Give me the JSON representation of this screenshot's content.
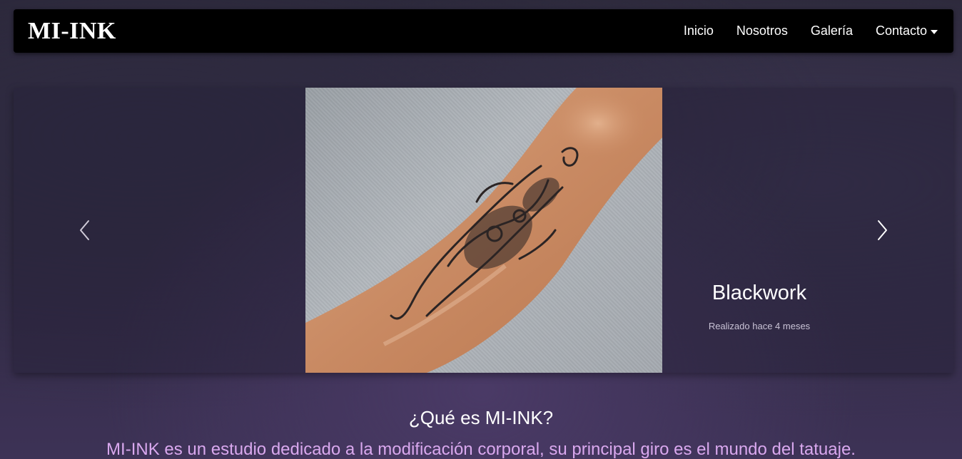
{
  "navbar": {
    "brand": "MI-INK",
    "links": [
      {
        "label": "Inicio"
      },
      {
        "label": "Nosotros"
      },
      {
        "label": "Galería"
      },
      {
        "label": "Contacto"
      }
    ]
  },
  "carousel": {
    "slide": {
      "title": "Blackwork",
      "subtitle": "Realizado hace 4 meses"
    },
    "prev_icon": "chevron-left-icon",
    "next_icon": "chevron-right-icon"
  },
  "about": {
    "title": "¿Qué es MI-INK?",
    "text": "MI-INK es un estudio dedicado a la modificación corporal, su principal giro es el mundo del tatuaje."
  },
  "colors": {
    "navbar_bg": "#000000",
    "accent_text": "#d9a8ee",
    "background": "#322b45"
  }
}
